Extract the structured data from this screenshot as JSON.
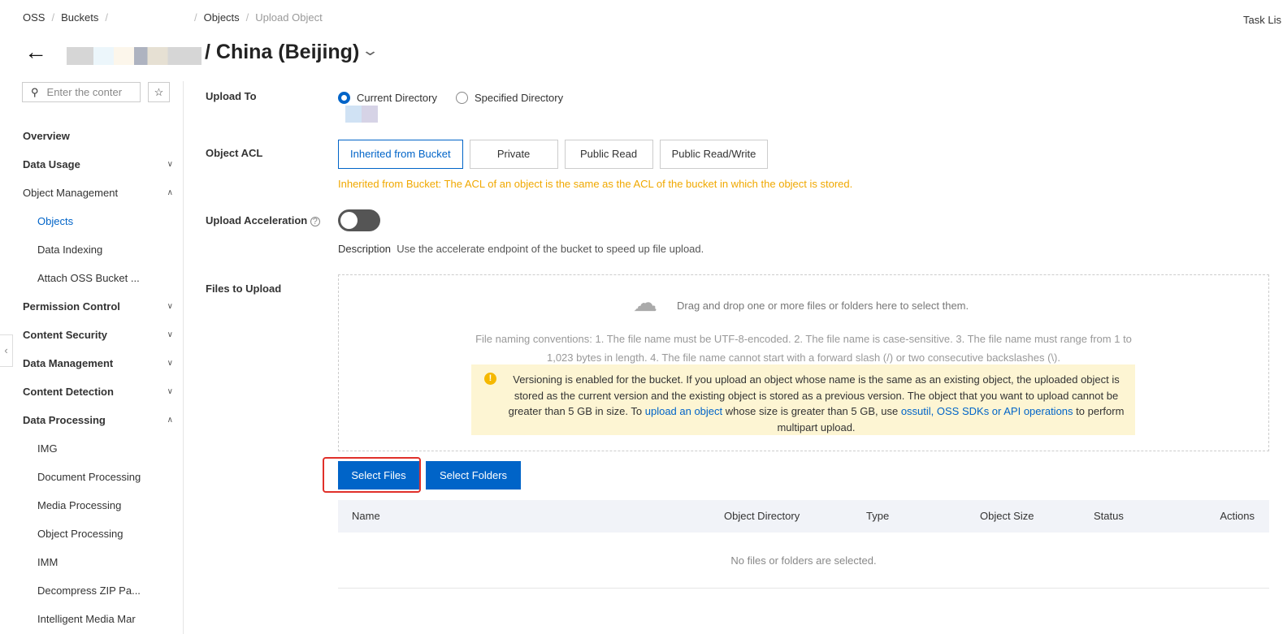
{
  "breadcrumb": {
    "oss": "OSS",
    "buckets": "Buckets",
    "objects": "Objects",
    "current": "Upload Object"
  },
  "header": {
    "task_list": "Task Lis",
    "title": "/ China (Beijing)"
  },
  "sidebar": {
    "search_placeholder": "Enter the conter",
    "items": [
      {
        "label": "Overview",
        "type": "top"
      },
      {
        "label": "Data Usage",
        "type": "top",
        "chevron": "down"
      },
      {
        "label": "Object Management",
        "type": "top-normal",
        "chevron": "up"
      },
      {
        "label": "Objects",
        "type": "sub",
        "active": true
      },
      {
        "label": "Data Indexing",
        "type": "sub"
      },
      {
        "label": "Attach OSS Bucket ...",
        "type": "sub"
      },
      {
        "label": "Permission Control",
        "type": "top",
        "chevron": "down"
      },
      {
        "label": "Content Security",
        "type": "top",
        "chevron": "down"
      },
      {
        "label": "Data Management",
        "type": "top",
        "chevron": "down"
      },
      {
        "label": "Content Detection",
        "type": "top",
        "chevron": "down"
      },
      {
        "label": "Data Processing",
        "type": "top",
        "chevron": "up"
      },
      {
        "label": "IMG",
        "type": "sub"
      },
      {
        "label": "Document Processing",
        "type": "sub"
      },
      {
        "label": "Media Processing",
        "type": "sub"
      },
      {
        "label": "Object Processing",
        "type": "sub"
      },
      {
        "label": "IMM",
        "type": "sub"
      },
      {
        "label": "Decompress ZIP Pa...",
        "type": "sub"
      },
      {
        "label": "Intelligent Media Mar",
        "type": "sub"
      }
    ]
  },
  "form": {
    "upload_to": {
      "label": "Upload To",
      "options": [
        "Current Directory",
        "Specified Directory"
      ],
      "selected": "Current Directory"
    },
    "acl": {
      "label": "Object ACL",
      "options": [
        "Inherited from Bucket",
        "Private",
        "Public Read",
        "Public Read/Write"
      ],
      "selected": "Inherited from Bucket",
      "hint": "Inherited from Bucket: The ACL of an object is the same as the ACL of the bucket in which the object is stored."
    },
    "acceleration": {
      "label": "Upload Acceleration",
      "enabled": false,
      "desc_label": "Description",
      "desc": "Use the accelerate endpoint of the bucket to speed up file upload."
    },
    "files": {
      "label": "Files to Upload",
      "drop_text": "Drag and drop one or more files or folders here to select them.",
      "naming1": "File naming conventions: 1. The file name must be UTF-8-encoded. 2. The file name is case-sensitive. 3. The file name must range from 1 to",
      "naming2": "1,023 bytes in length. 4. The file name cannot start with a forward slash (/) or two consecutive backslashes (\\).",
      "note_a": "Versioning is enabled for the bucket. If you upload an object whose name is the same as an existing object, the uploaded object is stored as the current version and the existing object is stored as a previous version. The object that you want to upload cannot be greater than 5 GB in size. To ",
      "note_link1": "upload an object",
      "note_b": " whose size is greater than 5 GB, use ",
      "note_link2": "ossutil, OSS SDKs or API operations",
      "note_c": " to perform multipart upload."
    }
  },
  "buttons": {
    "select_files": "Select Files",
    "select_folders": "Select Folders"
  },
  "table": {
    "columns": [
      "Name",
      "Object Directory",
      "Type",
      "Object Size",
      "Status",
      "Actions"
    ],
    "empty": "No files or folders are selected."
  }
}
